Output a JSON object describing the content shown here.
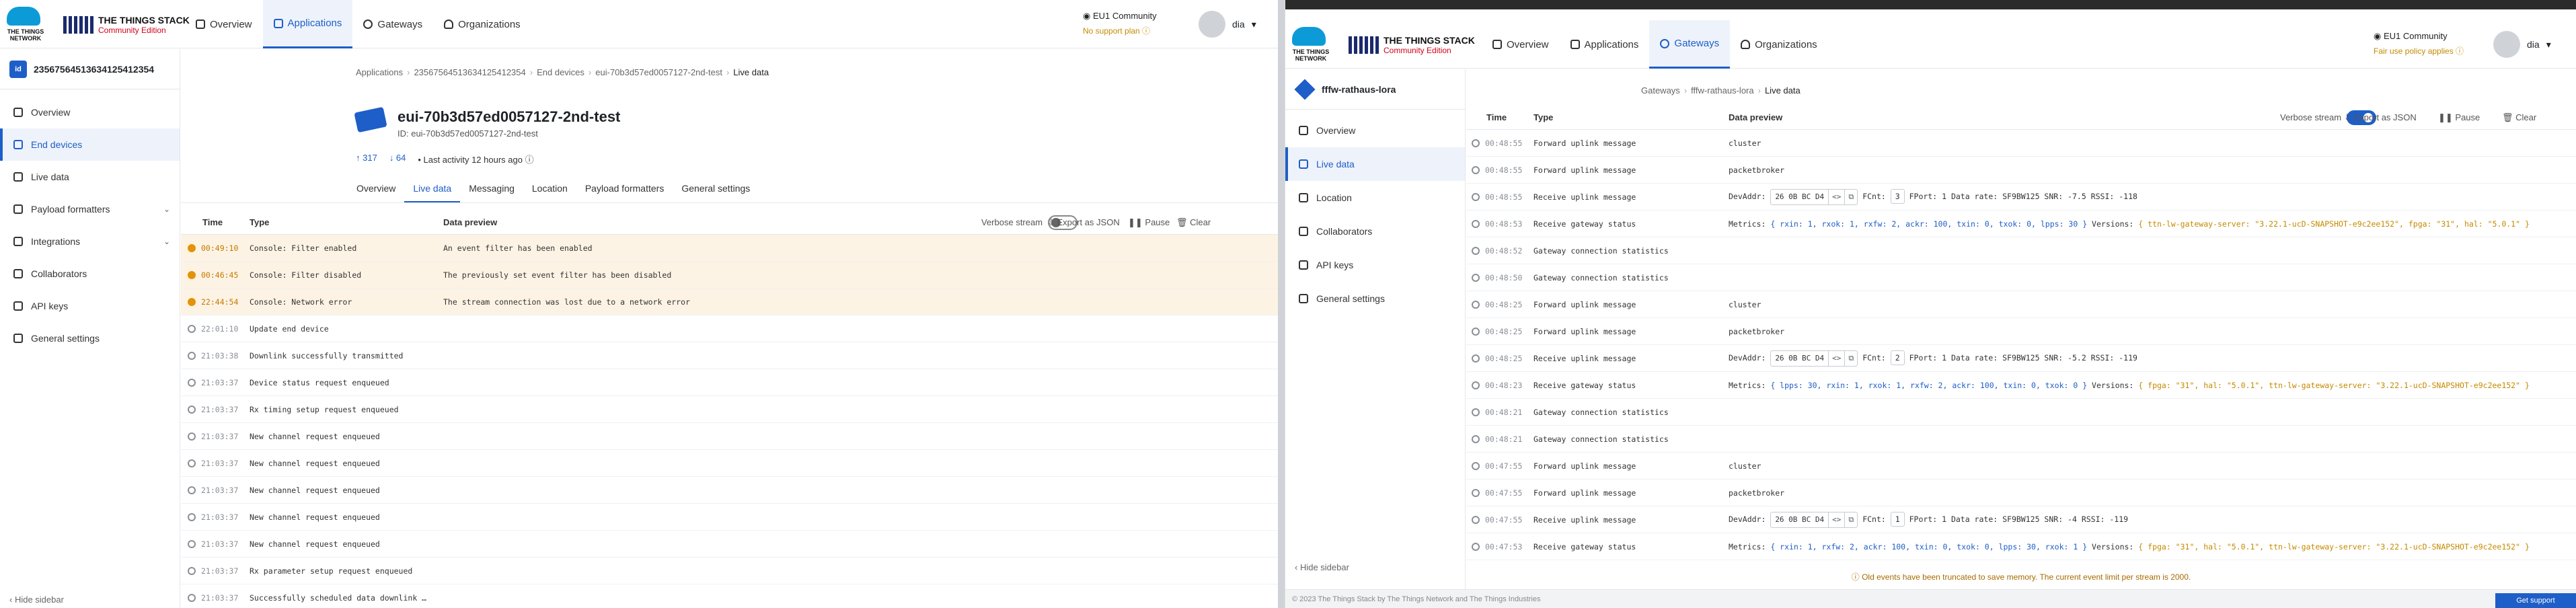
{
  "brand": {
    "logo_text": "THE THINGS NETWORK",
    "stack_title": "THE THINGS STACK",
    "stack_edition": "Community Edition"
  },
  "left": {
    "nav": [
      {
        "label": "Overview",
        "icon": "grid-icon",
        "active": false
      },
      {
        "label": "Applications",
        "icon": "app-icon",
        "active": true
      },
      {
        "label": "Gateways",
        "icon": "gateway-icon",
        "active": false
      },
      {
        "label": "Organizations",
        "icon": "people-icon",
        "active": false
      }
    ],
    "network": "EU1 Community",
    "network_sub": "No support plan ⓘ",
    "user": "dia",
    "entity_name": "23567564513634125412354",
    "entity_badge": "id",
    "sidebar": [
      {
        "label": "Overview",
        "active": false,
        "expand": false
      },
      {
        "label": "End devices",
        "active": true,
        "expand": false
      },
      {
        "label": "Live data",
        "active": false,
        "expand": false
      },
      {
        "label": "Payload formatters",
        "active": false,
        "expand": true
      },
      {
        "label": "Integrations",
        "active": false,
        "expand": true
      },
      {
        "label": "Collaborators",
        "active": false,
        "expand": false
      },
      {
        "label": "API keys",
        "active": false,
        "expand": false
      },
      {
        "label": "General settings",
        "active": false,
        "expand": false
      }
    ],
    "hide_sidebar": "‹ Hide sidebar",
    "breadcrumb": [
      "Applications",
      "23567564513634125412354",
      "End devices",
      "eui-70b3d57ed0057127-2nd-test",
      "Live data"
    ],
    "device_title": "eui-70b3d57ed0057127-2nd-test",
    "device_id": "ID: eui-70b3d57ed0057127-2nd-test",
    "stat_up": "↑ 317",
    "stat_down": "↓ 64",
    "last_activity": "• Last activity 12 hours ago ⓘ",
    "tabs": [
      {
        "label": "Overview",
        "active": false
      },
      {
        "label": "Live data",
        "active": true
      },
      {
        "label": "Messaging",
        "active": false
      },
      {
        "label": "Location",
        "active": false
      },
      {
        "label": "Payload formatters",
        "active": false
      },
      {
        "label": "General settings",
        "active": false
      }
    ],
    "table": {
      "col_time": "Time",
      "col_type": "Type",
      "col_preview": "Data preview",
      "verbose_label": "Verbose stream",
      "export": "⇩ Export as JSON",
      "pause": "❚❚ Pause",
      "clear": "🗑 Clear"
    },
    "events": [
      {
        "time": "00:49:10",
        "type": "Console: Filter enabled",
        "preview": "An event filter has been enabled",
        "warn": true
      },
      {
        "time": "00:46:45",
        "type": "Console: Filter disabled",
        "preview": "The previously set event filter has been disabled",
        "warn": true
      },
      {
        "time": "22:44:54",
        "type": "Console: Network error",
        "preview": "The stream connection was lost due to a network error",
        "warn": true
      },
      {
        "time": "22:01:10",
        "type": "Update end device",
        "preview": "",
        "warn": false
      },
      {
        "time": "21:03:38",
        "type": "Downlink successfully transmitted",
        "preview": "",
        "warn": false
      },
      {
        "time": "21:03:37",
        "type": "Device status request enqueued",
        "preview": "",
        "warn": false
      },
      {
        "time": "21:03:37",
        "type": "Rx timing setup request enqueued",
        "preview": "",
        "warn": false
      },
      {
        "time": "21:03:37",
        "type": "New channel request enqueued",
        "preview": "",
        "warn": false
      },
      {
        "time": "21:03:37",
        "type": "New channel request enqueued",
        "preview": "",
        "warn": false
      },
      {
        "time": "21:03:37",
        "type": "New channel request enqueued",
        "preview": "",
        "warn": false
      },
      {
        "time": "21:03:37",
        "type": "New channel request enqueued",
        "preview": "",
        "warn": false
      },
      {
        "time": "21:03:37",
        "type": "New channel request enqueued",
        "preview": "",
        "warn": false
      },
      {
        "time": "21:03:37",
        "type": "Rx parameter setup request enqueued",
        "preview": "",
        "warn": false
      },
      {
        "time": "21:03:37",
        "type": "Successfully scheduled data downlink …",
        "preview": "",
        "warn": false
      }
    ]
  },
  "right": {
    "nav": [
      {
        "label": "Overview",
        "active": false
      },
      {
        "label": "Applications",
        "active": false
      },
      {
        "label": "Gateways",
        "active": true
      },
      {
        "label": "Organizations",
        "active": false
      }
    ],
    "network": "EU1 Community",
    "network_sub": "Fair use policy applies ⓘ",
    "user": "dia",
    "entity_name": "fffw-rathaus-lora",
    "sidebar": [
      {
        "label": "Overview",
        "active": false
      },
      {
        "label": "Live data",
        "active": true
      },
      {
        "label": "Location",
        "active": false
      },
      {
        "label": "Collaborators",
        "active": false
      },
      {
        "label": "API keys",
        "active": false
      },
      {
        "label": "General settings",
        "active": false
      }
    ],
    "hide_sidebar": "‹ Hide sidebar",
    "breadcrumb": [
      "Gateways",
      "fffw-rathaus-lora",
      "Live data"
    ],
    "table": {
      "col_time": "Time",
      "col_type": "Type",
      "col_preview": "Data preview",
      "verbose_label": "Verbose stream",
      "export": "⇩ Export as JSON",
      "pause": "❚❚ Pause",
      "clear": "🗑 Clear"
    },
    "devaddr": "26 0B BC D4",
    "events": [
      {
        "time": "00:48:55",
        "type": "Forward uplink message",
        "kind": "text",
        "preview": "cluster"
      },
      {
        "time": "00:48:55",
        "type": "Forward uplink message",
        "kind": "text",
        "preview": "packetbroker"
      },
      {
        "time": "00:48:55",
        "type": "Receive uplink message",
        "kind": "uplink",
        "fcnt": "3",
        "fport": "1",
        "rate": "SF9BW125",
        "snr": "-7.5",
        "rssi": "-118"
      },
      {
        "time": "00:48:53",
        "type": "Receive gateway status",
        "kind": "status",
        "metrics": "{ rxin: 1, rxok: 1, rxfw: 2, ackr: 100, txin: 0, txok: 0, lpps: 30 }",
        "versions": "{ ttn-lw-gateway-server: \"3.22.1-ucD-SNAPSHOT-e9c2ee152\", fpga: \"31\", hal: \"5.0.1\" }"
      },
      {
        "time": "00:48:52",
        "type": "Gateway connection statistics",
        "kind": "text",
        "preview": ""
      },
      {
        "time": "00:48:50",
        "type": "Gateway connection statistics",
        "kind": "text",
        "preview": ""
      },
      {
        "time": "00:48:25",
        "type": "Forward uplink message",
        "kind": "text",
        "preview": "cluster"
      },
      {
        "time": "00:48:25",
        "type": "Forward uplink message",
        "kind": "text",
        "preview": "packetbroker"
      },
      {
        "time": "00:48:25",
        "type": "Receive uplink message",
        "kind": "uplink",
        "fcnt": "2",
        "fport": "1",
        "rate": "SF9BW125",
        "snr": "-5.2",
        "rssi": "-119"
      },
      {
        "time": "00:48:23",
        "type": "Receive gateway status",
        "kind": "status",
        "metrics": "{ lpps: 30, rxin: 1, rxok: 1, rxfw: 2, ackr: 100, txin: 0, txok: 0 }",
        "versions": "{ fpga: \"31\", hal: \"5.0.1\", ttn-lw-gateway-server: \"3.22.1-ucD-SNAPSHOT-e9c2ee152\" }"
      },
      {
        "time": "00:48:21",
        "type": "Gateway connection statistics",
        "kind": "text",
        "preview": ""
      },
      {
        "time": "00:48:21",
        "type": "Gateway connection statistics",
        "kind": "text",
        "preview": ""
      },
      {
        "time": "00:47:55",
        "type": "Forward uplink message",
        "kind": "text",
        "preview": "cluster"
      },
      {
        "time": "00:47:55",
        "type": "Forward uplink message",
        "kind": "text",
        "preview": "packetbroker"
      },
      {
        "time": "00:47:55",
        "type": "Receive uplink message",
        "kind": "uplink",
        "fcnt": "1",
        "fport": "1",
        "rate": "SF9BW125",
        "snr": "-4",
        "rssi": "-119"
      },
      {
        "time": "00:47:53",
        "type": "Receive gateway status",
        "kind": "status",
        "metrics": "{ rxin: 1, rxfw: 2, ackr: 100, txin: 0, txok: 0, lpps: 30, rxok: 1 }",
        "versions": "{ fpga: \"31\", hal: \"5.0.1\", ttn-lw-gateway-server: \"3.22.1-ucD-SNAPSHOT-e9c2ee152\" }"
      }
    ],
    "trunc_note": "ⓘ Old events have been truncated to save memory. The current event limit per stream is 2000.",
    "footer": "© 2023 The Things Stack by The Things Network and The Things Industries",
    "feedback": "Get support"
  },
  "colors": {
    "accent": "#1e5ec8",
    "warning": "#e2930b",
    "warn_bg": "#fdf3e4"
  }
}
